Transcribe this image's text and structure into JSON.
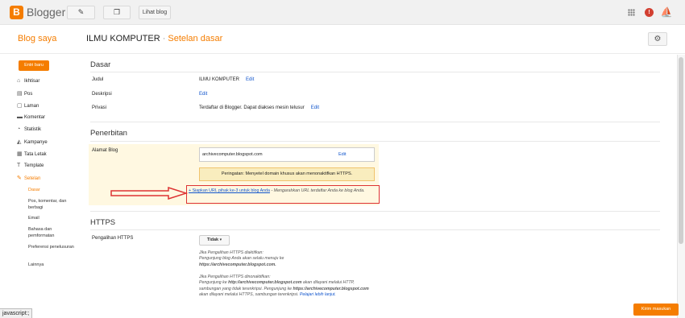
{
  "app": {
    "logo_letter": "B",
    "name": "Blogger",
    "view_blog": "Lihat blog",
    "notif_count": "!"
  },
  "header": {
    "blog_saya": "Blog saya",
    "blog_name": "ILMU KOMPUTER",
    "separator": "·",
    "page": "Setelan dasar"
  },
  "sidebar": {
    "new_post": "Entri baru",
    "items": [
      {
        "label": "Ikhtisar",
        "icon": "home-icon"
      },
      {
        "label": "Pos",
        "icon": "posts-icon"
      },
      {
        "label": "Laman",
        "icon": "pages-icon"
      },
      {
        "label": "Komentar",
        "icon": "comments-icon"
      },
      {
        "label": "Statistik",
        "icon": "stats-icon"
      },
      {
        "label": "Kampanye",
        "icon": "campaigns-icon"
      },
      {
        "label": "Tata Letak",
        "icon": "layout-icon"
      },
      {
        "label": "Template",
        "icon": "template-icon"
      },
      {
        "label": "Setelan",
        "icon": "wrench-icon"
      }
    ],
    "subitems": [
      "Dasar",
      "Pos, komentar, dan berbagi",
      "Email",
      "Bahasa dan pemformatan",
      "Preferensi penelusuran",
      "Lainnya"
    ]
  },
  "sections": {
    "dasar": {
      "title": "Dasar",
      "judul_label": "Judul",
      "judul_value": "ILMU KOMPUTER",
      "deskripsi_label": "Deskripsi",
      "privasi_label": "Privasi",
      "privasi_value": "Terdaftar di Blogger. Dapat diakses mesin telusur"
    },
    "penerbitan": {
      "title": "Penerbitan",
      "alamat_label": "Alamat Blog",
      "alamat_value": "archivecomputer.blogspot.com",
      "warning": "Peringatan: Menyetel domain khusus akan menonaktifkan HTTPS.",
      "setup_link": "+ Siapkan URL pihak ke-3 untuk blog Anda",
      "setup_desc": " - Mengarahkan URL terdaftar Anda ke blog Anda."
    },
    "https": {
      "title": "HTTPS",
      "redirect_label": "Pengalihan HTTPS",
      "redirect_value": "Tidak",
      "on_title": "Jika Pengalihan HTTPS diaktifkan:",
      "on_text": "Pengunjung blog Anda akan selalu menuju ke",
      "on_url": "https://archivecomputer.blogspot.com.",
      "off_title": "Jika Pengalihan HTTPS dinonaktifkan:",
      "off_text1": "Pengunjung ke ",
      "off_url1": "http://archivecomputer.blogspot.com",
      "off_text2": " akan dilayani melalui HTTP, sambungan yang tidak terenkripsi. Pengunjung ke ",
      "off_url2": "https://archivecomputer.blogspot.com",
      "off_text3": " akan dilayani melalui HTTPS, sambungan terenkripsi. ",
      "learn_more": "Pelajari lebih lanjut."
    }
  },
  "common": {
    "edit": "Edit"
  },
  "status_bar": "javascript:;",
  "feedback": "Kirim masukan",
  "colors": {
    "accent": "#f57d00",
    "link": "#1155cc",
    "highlight_bg": "#fff8e1",
    "annotation_red": "#dd3333"
  }
}
